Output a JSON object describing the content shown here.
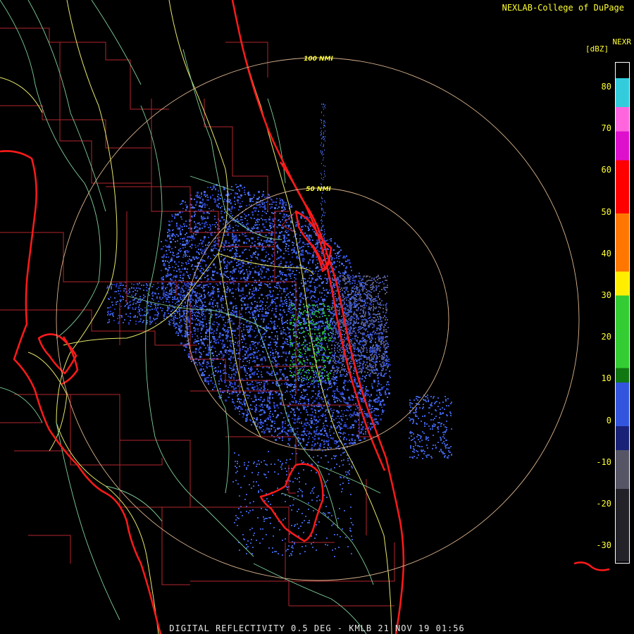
{
  "header": {
    "credit": "NEXLAB-College of DuPage",
    "product": "NEXR",
    "unit": "[dBZ]"
  },
  "range_rings": [
    {
      "label": "50 NMI"
    },
    {
      "label": "100 NMI"
    }
  ],
  "colorbar": {
    "ticks": [
      "80",
      "70",
      "60",
      "50",
      "40",
      "30",
      "20",
      "10",
      "0",
      "-10",
      "-20",
      "-30"
    ],
    "colors": {
      "cyan": "#33ccdd",
      "pink": "#ff66dd",
      "magenta": "#dd11cc",
      "red": "#ff0000",
      "orange": "#ff7700",
      "yellow": "#ffee00",
      "green": "#33cc33",
      "dkgreen": "#117711",
      "blue": "#3355dd",
      "navy": "#1a2277",
      "gray": "#555566",
      "dark": "#222228"
    }
  },
  "caption": "DIGITAL REFLECTIVITY 0.5 DEG - KMLB 21 NOV 19 01:56",
  "colors": {
    "coast": "#ff1a1a",
    "county": "#b3262e",
    "highway": "#e8e86a",
    "road": "#7fcf9a",
    "ring": "#d9b38c",
    "echo_low": "#3a5acd",
    "echo_mid": "#2233aa",
    "echo_green": "#22aa33"
  }
}
